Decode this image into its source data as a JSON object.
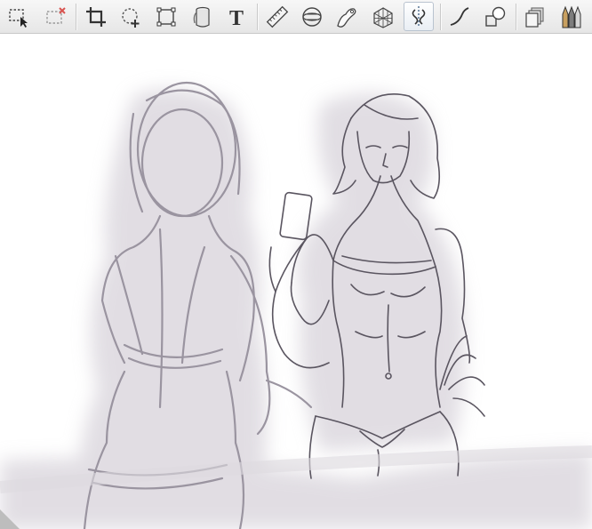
{
  "toolbar": {
    "tools": [
      {
        "name": "rectangular-selection",
        "icon": "selection-arrow-icon",
        "active": false
      },
      {
        "name": "clear-selection",
        "icon": "selection-clear-icon",
        "active": false
      },
      {
        "name": "crop",
        "icon": "crop-icon",
        "active": false
      },
      {
        "name": "lasso-transform",
        "icon": "lasso-plus-icon",
        "active": false
      },
      {
        "name": "transform",
        "icon": "transform-box-icon",
        "active": false
      },
      {
        "name": "fill",
        "icon": "paint-bucket-icon",
        "active": false
      },
      {
        "name": "text",
        "icon": "text-icon",
        "active": false,
        "glyph": "T"
      },
      {
        "name": "ruler",
        "icon": "ruler-icon",
        "active": false
      },
      {
        "name": "ellipse-guide",
        "icon": "ellipse-guide-icon",
        "active": false
      },
      {
        "name": "french-curve",
        "icon": "french-curve-icon",
        "active": false
      },
      {
        "name": "perspective-guide",
        "icon": "perspective-grid-icon",
        "active": false
      },
      {
        "name": "symmetry",
        "icon": "symmetry-icon",
        "active": true
      },
      {
        "name": "curve-stroke",
        "icon": "curve-stroke-icon",
        "active": false
      },
      {
        "name": "shape",
        "icon": "shape-icon",
        "active": false
      },
      {
        "name": "layers",
        "icon": "layers-icon",
        "active": false
      },
      {
        "name": "brush-library",
        "icon": "brush-library-icon",
        "active": false
      }
    ],
    "accent": "#4a6a8c"
  },
  "canvas": {
    "description_color": "#5a5560",
    "shadow_color": "#b9b3bf"
  }
}
